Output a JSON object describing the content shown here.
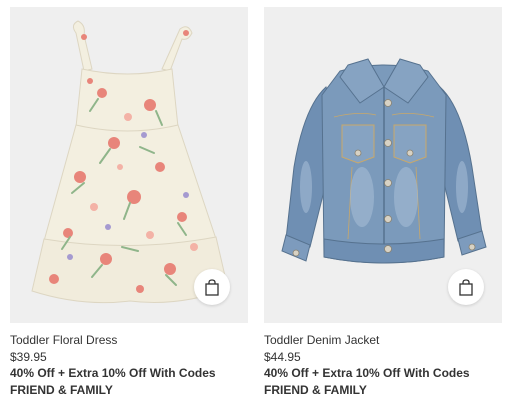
{
  "products": [
    {
      "name": "Toddler Floral Dress",
      "price": "$39.95",
      "promo_line1": "40% Off + Extra 10% Off With Codes",
      "promo_line2": "FRIEND & FAMILY",
      "image_icon": "floral-dress-image",
      "bag_icon": "shopping-bag-icon"
    },
    {
      "name": "Toddler Denim Jacket",
      "price": "$44.95",
      "promo_line1": "40% Off + Extra 10% Off With Codes",
      "promo_line2": "FRIEND & FAMILY",
      "image_icon": "denim-jacket-image",
      "bag_icon": "shopping-bag-icon"
    }
  ],
  "colors": {
    "image_bg": "#efefef",
    "text": "#333333",
    "dress_base": "#f3efe0",
    "flower_pink": "#e8857a",
    "leaf_green": "#8fb58a",
    "denim": "#6f8fb3"
  }
}
